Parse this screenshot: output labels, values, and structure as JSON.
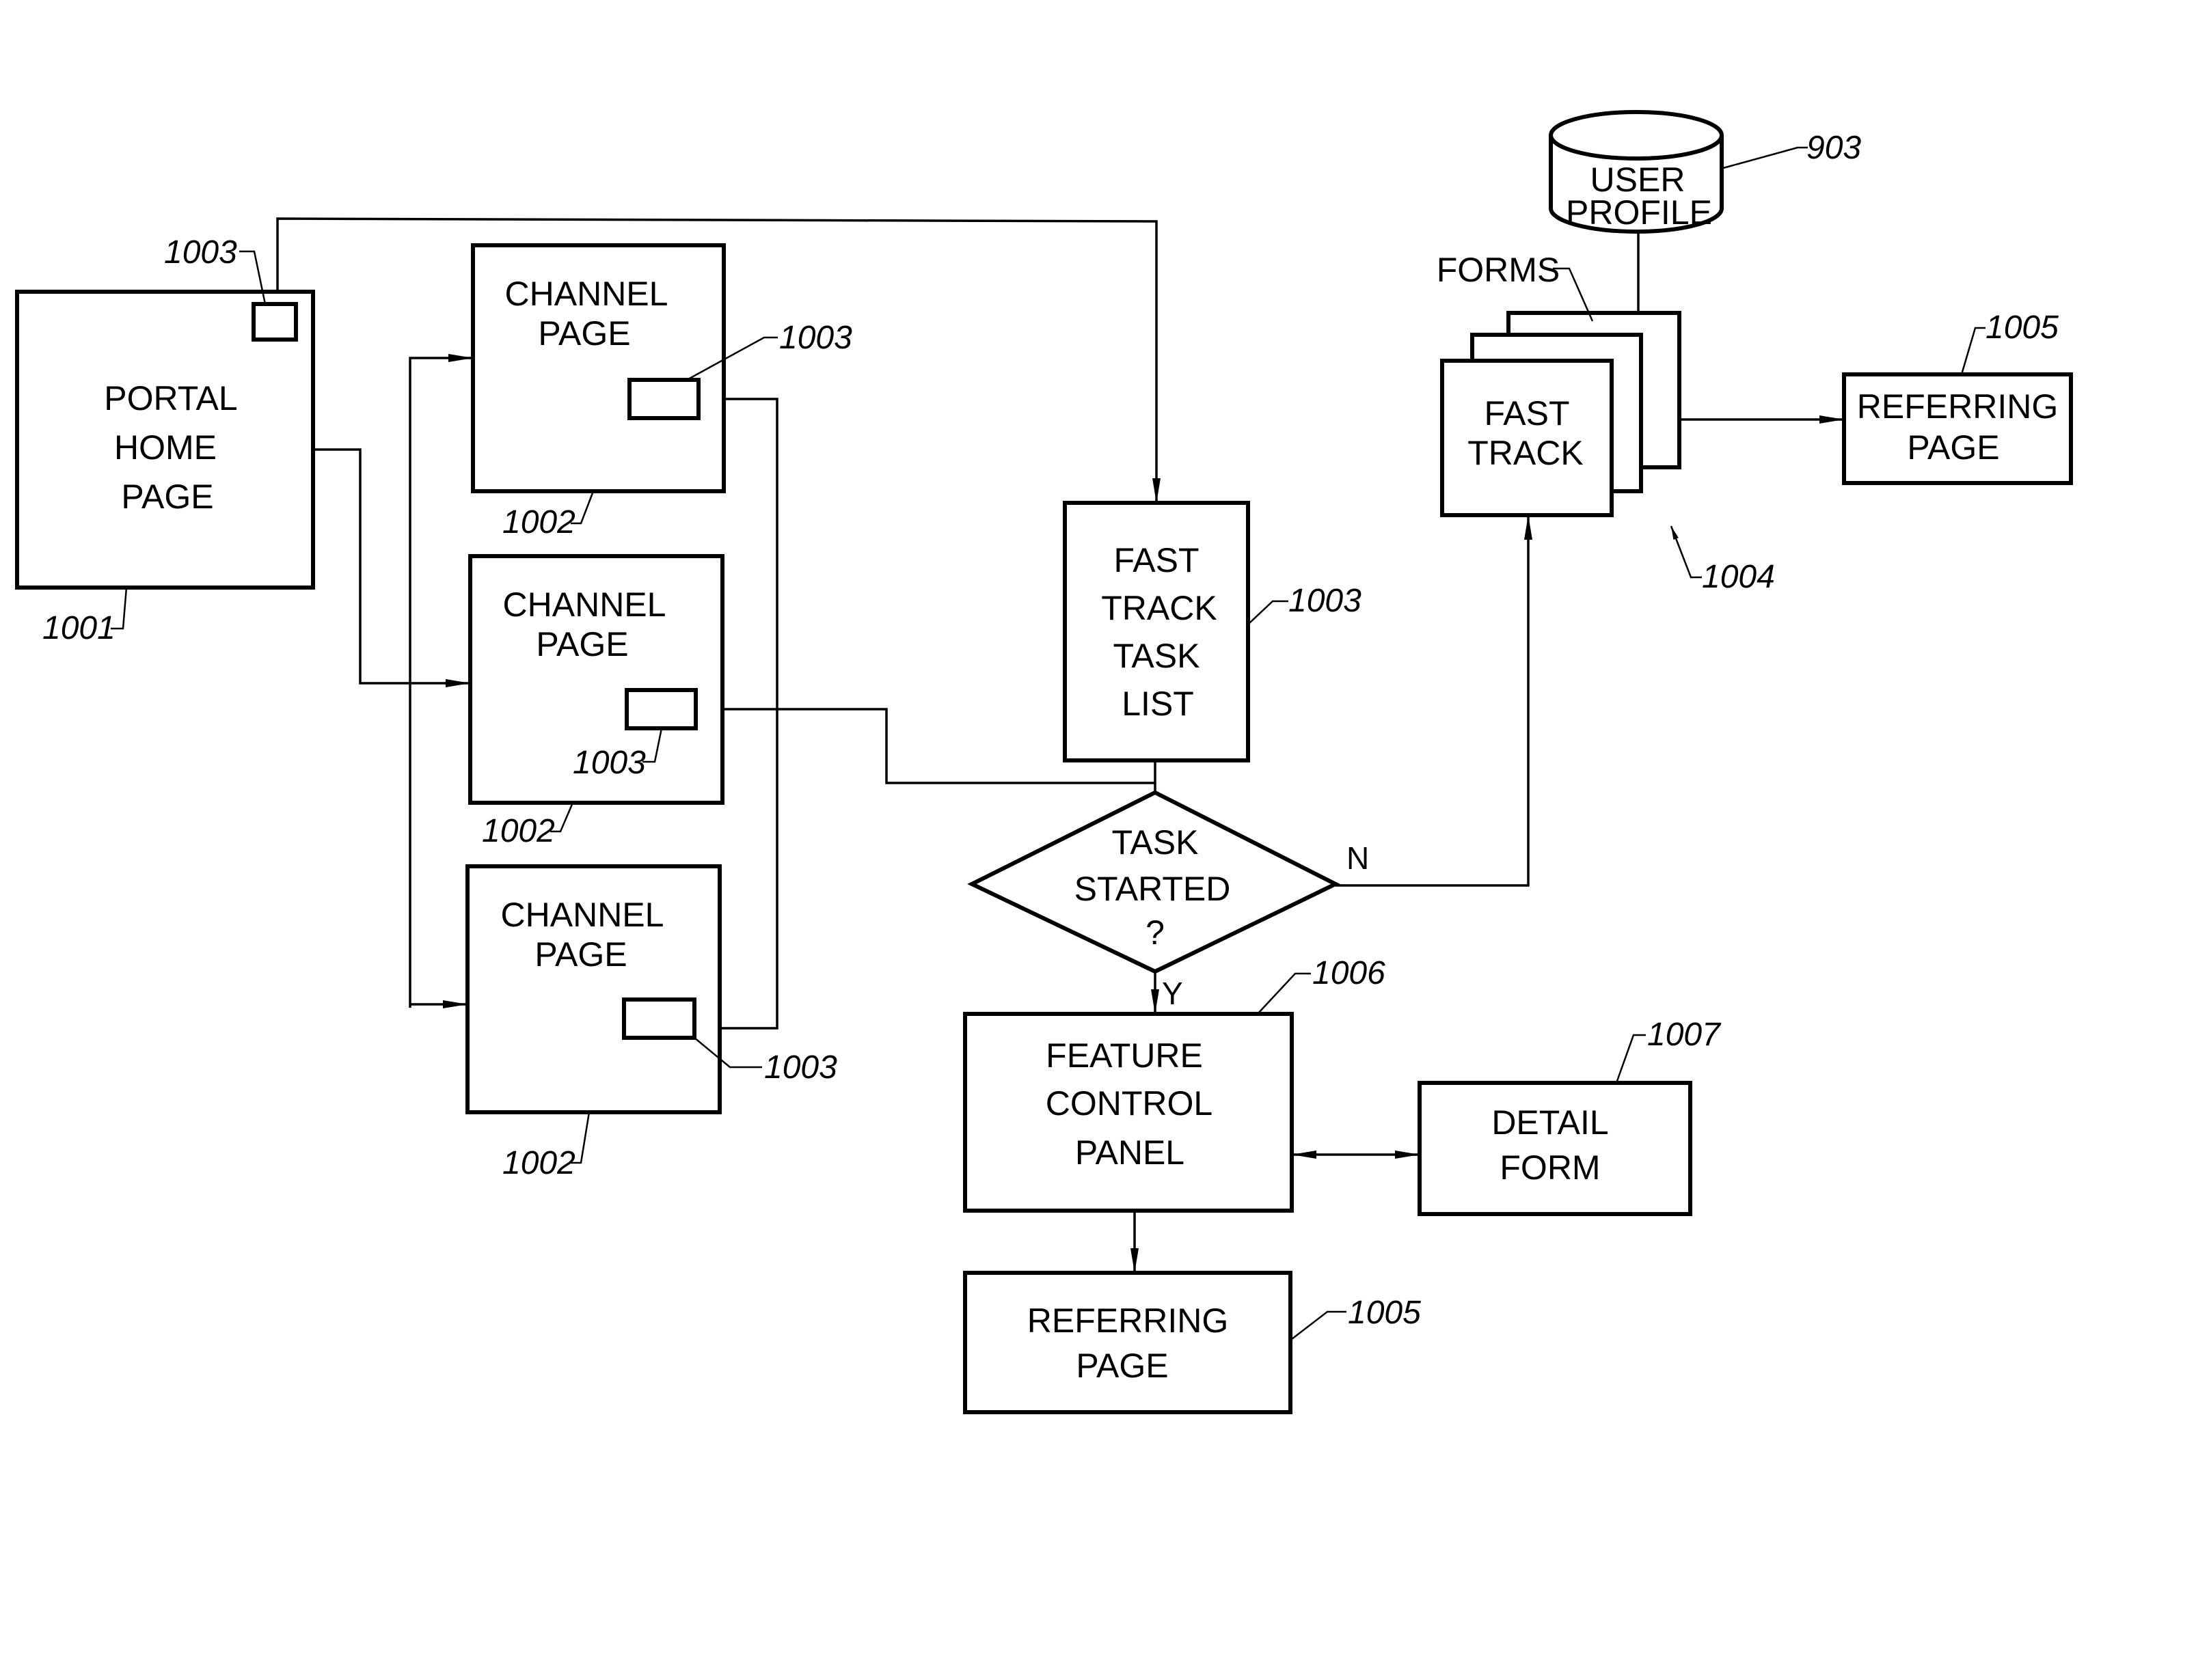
{
  "figure": {
    "nodes": {
      "portal_home": {
        "lines": [
          "PORTAL",
          "HOME",
          "PAGE"
        ],
        "ref": "1001",
        "link_ref": "1003"
      },
      "channel_pages": [
        {
          "lines": [
            "CHANNEL",
            "PAGE"
          ],
          "ref": "1002",
          "link_ref": "1003"
        },
        {
          "lines": [
            "CHANNEL",
            "PAGE"
          ],
          "ref": "1002",
          "link_ref": "1003"
        },
        {
          "lines": [
            "CHANNEL",
            "PAGE"
          ],
          "ref": "1002",
          "link_ref": "1003"
        }
      ],
      "fast_track_task_list": {
        "lines": [
          "FAST",
          "TRACK",
          "TASK",
          "LIST"
        ],
        "ref": "1003"
      },
      "decision": {
        "lines": [
          "TASK",
          "STARTED",
          "?"
        ],
        "yes": "Y",
        "no": "N"
      },
      "feature_control_panel": {
        "lines": [
          "FEATURE",
          "CONTROL",
          "PANEL"
        ],
        "ref": "1006"
      },
      "detail_form": {
        "lines": [
          "DETAIL",
          "FORM"
        ],
        "ref": "1007"
      },
      "referring_page_bottom": {
        "lines": [
          "REFERRING",
          "PAGE"
        ],
        "ref": "1005"
      },
      "user_profile": {
        "lines": [
          "USER",
          "PROFILE"
        ],
        "ref": "903"
      },
      "fast_track_forms": {
        "lines": [
          "FAST",
          "TRACK"
        ],
        "stack_label": "FORMS",
        "ref": "1004"
      },
      "referring_page_top": {
        "lines": [
          "REFERRING",
          "PAGE"
        ],
        "ref": "1005"
      }
    }
  }
}
